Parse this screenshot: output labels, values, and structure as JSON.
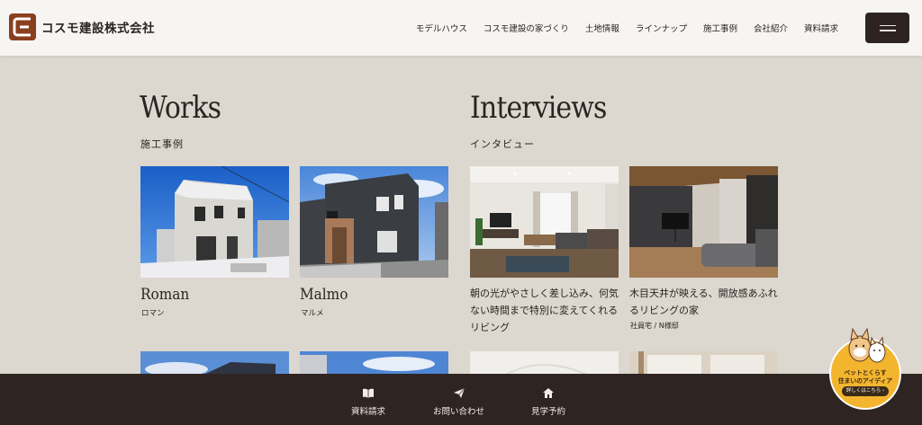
{
  "header": {
    "logo_text": "コスモ建設株式会社",
    "nav": [
      "モデルハウス",
      "コスモ建設の家づくり",
      "土地情報",
      "ラインナップ",
      "施工事例",
      "会社紹介",
      "資料請求"
    ]
  },
  "works": {
    "title": "Works",
    "subtitle": "施工事例",
    "items": [
      {
        "name": "Roman",
        "kana": "ロマン"
      },
      {
        "name": "Malmo",
        "kana": "マルメ"
      }
    ]
  },
  "interviews": {
    "title": "Interviews",
    "subtitle": "インタビュー",
    "items": [
      {
        "text": "朝の光がやさしく差し込み、何気ない時間まで特別に変えてくれるリビング",
        "meta": ""
      },
      {
        "text": "木目天井が映える、開放感あふれるリビングの家",
        "meta": "社員宅 / N様邸"
      }
    ]
  },
  "footer": {
    "items": [
      {
        "label": "資料請求",
        "icon": "book-icon"
      },
      {
        "label": "お問い合わせ",
        "icon": "paper-plane-icon"
      },
      {
        "label": "見学予約",
        "icon": "house-icon"
      }
    ]
  },
  "pet_badge": {
    "line1": "ペットとくらす",
    "line2": "住まいのアイディア",
    "cta": "詳しくはこちら ›"
  },
  "colors": {
    "background": "#dcd7cf",
    "header": "#f6f5f2",
    "footer": "#2e2522",
    "accent": "#f3b52e"
  }
}
